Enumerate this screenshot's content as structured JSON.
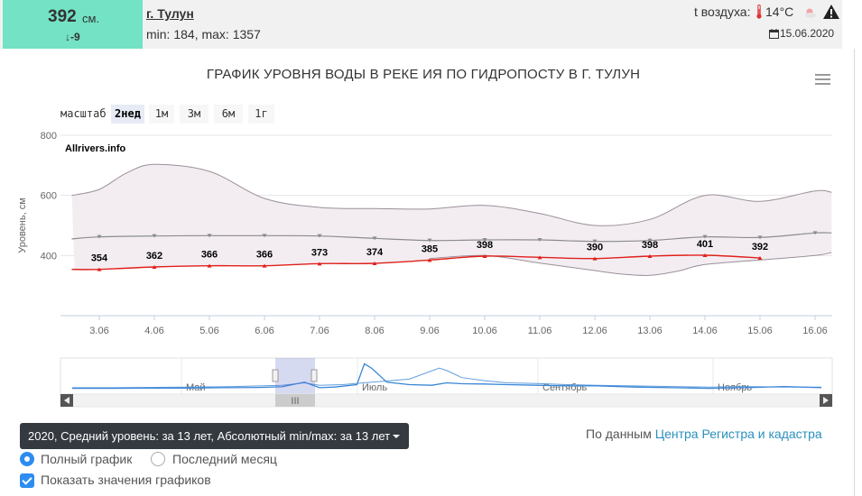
{
  "header": {
    "level_value": "392",
    "level_unit": "см.",
    "level_change": "-9",
    "city": "г. Тулун",
    "minmax": "min: 184, max: 1357",
    "air_label": "t воздуха:",
    "air_value": "14°C",
    "date": "15.06.2020"
  },
  "zoom": {
    "label": "масштаб",
    "buttons": [
      "2нед",
      "1м",
      "3м",
      "6м",
      "1г"
    ],
    "active": "2нед"
  },
  "navigator": {
    "months": [
      "Май",
      "Июль",
      "Сентябрь",
      "Ноябрь"
    ],
    "handle_label": "III"
  },
  "controls": {
    "dropdown": "2020, Средний уровень: за 13 лет, Абсолютный min/max: за 13 лет",
    "source_prefix": "По данным",
    "source_link": "Центра Регистра и кадастра",
    "radio_1": "Полный график",
    "radio_2": "Последний месяц",
    "checkbox": "Показать значения графиков"
  },
  "colors": {
    "current": "#e0201b",
    "average": "#8c8c8c",
    "band_fill": "#f3edf2",
    "band_line": "#9b9099",
    "navigator": "#3b86d6"
  },
  "chart_data": {
    "type": "line",
    "title": "ГРАФИК УРОВНЯ ВОДЫ В РЕКЕ ИЯ ПО ГИДРОПОСТУ В Г. ТУЛУН",
    "ylabel": "Уровень, см",
    "watermark": "Allrivers.info",
    "ylim": [
      200,
      800
    ],
    "yticks": [
      400,
      600,
      800
    ],
    "categories": [
      "3.06",
      "4.06",
      "5.06",
      "6.06",
      "7.06",
      "8.06",
      "9.06",
      "10.06",
      "11.06",
      "12.06",
      "13.06",
      "14.06",
      "15.06",
      "16.06"
    ],
    "current": {
      "x": [
        2.5,
        3,
        4,
        5,
        6,
        7,
        8,
        9,
        10,
        11,
        12,
        13,
        14,
        15
      ],
      "values": [
        354,
        354,
        362,
        366,
        366,
        373,
        374,
        385,
        398,
        394,
        390,
        398,
        401,
        392
      ],
      "labeled_days": [
        3,
        4,
        5,
        6,
        7,
        8,
        9,
        10,
        12,
        13,
        14,
        15
      ]
    },
    "average": {
      "x": [
        2.5,
        3,
        4,
        5,
        6,
        7,
        8,
        9,
        10,
        11,
        12,
        13,
        14,
        15,
        16,
        16.3
      ],
      "values": [
        455,
        462,
        465,
        466,
        466,
        465,
        457,
        450,
        452,
        452,
        447,
        450,
        462,
        460,
        475,
        475
      ]
    },
    "abs_max": {
      "x": [
        2.5,
        3,
        3.5,
        4,
        5,
        6,
        7,
        8,
        9,
        10,
        11,
        12,
        13,
        14,
        15,
        16,
        16.3
      ],
      "values": [
        600,
        620,
        675,
        703,
        680,
        590,
        560,
        556,
        555,
        567,
        540,
        500,
        520,
        600,
        580,
        615,
        610
      ]
    },
    "abs_min": {
      "x": [
        9,
        10,
        11,
        12,
        12.5,
        13,
        13.5,
        14,
        15,
        16,
        16.3
      ],
      "values": [
        390,
        400,
        375,
        350,
        338,
        334,
        348,
        370,
        385,
        400,
        410
      ]
    },
    "navigator": {
      "ylim": [
        0,
        100
      ],
      "series_a": [
        [
          0,
          10
        ],
        [
          0.05,
          10
        ],
        [
          0.1,
          11
        ],
        [
          0.15,
          11
        ],
        [
          0.2,
          12
        ],
        [
          0.25,
          13
        ],
        [
          0.28,
          15
        ],
        [
          0.31,
          30
        ],
        [
          0.33,
          12
        ],
        [
          0.35,
          14
        ],
        [
          0.38,
          22
        ],
        [
          0.39,
          90
        ],
        [
          0.4,
          75
        ],
        [
          0.42,
          30
        ],
        [
          0.45,
          22
        ],
        [
          0.48,
          20
        ],
        [
          0.5,
          28
        ],
        [
          0.52,
          25
        ],
        [
          0.55,
          24
        ],
        [
          0.58,
          22
        ],
        [
          0.62,
          20
        ],
        [
          0.66,
          18
        ],
        [
          0.7,
          18
        ],
        [
          0.75,
          14
        ],
        [
          0.8,
          12
        ],
        [
          0.85,
          10
        ],
        [
          0.9,
          12
        ],
        [
          0.95,
          16
        ],
        [
          1,
          12
        ]
      ],
      "series_b": [
        [
          0,
          12
        ],
        [
          0.05,
          12
        ],
        [
          0.1,
          13
        ],
        [
          0.15,
          14
        ],
        [
          0.2,
          15
        ],
        [
          0.25,
          18
        ],
        [
          0.28,
          20
        ],
        [
          0.31,
          28
        ],
        [
          0.33,
          20
        ],
        [
          0.36,
          22
        ],
        [
          0.4,
          30
        ],
        [
          0.45,
          40
        ],
        [
          0.49,
          76
        ],
        [
          0.5,
          68
        ],
        [
          0.52,
          45
        ],
        [
          0.55,
          35
        ],
        [
          0.58,
          28
        ],
        [
          0.62,
          26
        ],
        [
          0.66,
          22
        ],
        [
          0.7,
          20
        ],
        [
          0.75,
          18
        ],
        [
          0.8,
          16
        ],
        [
          0.85,
          14
        ],
        [
          0.9,
          16
        ],
        [
          0.95,
          14
        ],
        [
          1,
          14
        ]
      ]
    }
  }
}
